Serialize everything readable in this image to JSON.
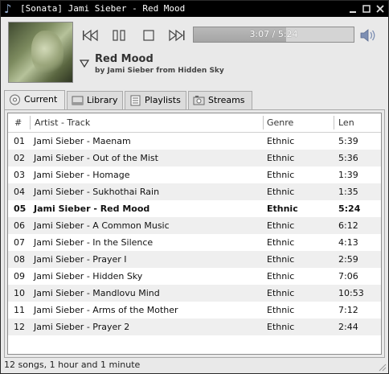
{
  "window": {
    "title": "[Sonata] Jami Sieber - Red Mood"
  },
  "player": {
    "progress_label": "3:07 / 5:24",
    "progress_fraction": 0.577,
    "song_title": "Red Mood",
    "song_subtitle": "by Jami Sieber from Hidden Sky"
  },
  "tabs": [
    {
      "label": "Current",
      "icon": "disc-icon",
      "active": true
    },
    {
      "label": "Library",
      "icon": "library-icon",
      "active": false
    },
    {
      "label": "Playlists",
      "icon": "playlist-icon",
      "active": false
    },
    {
      "label": "Streams",
      "icon": "streams-icon",
      "active": false
    }
  ],
  "playlist": {
    "columns": [
      "#",
      "Artist - Track",
      "Genre",
      "Len"
    ],
    "current_index": 4,
    "rows": [
      {
        "num": "01",
        "track": "Jami Sieber - Maenam",
        "genre": "Ethnic",
        "len": "5:39"
      },
      {
        "num": "02",
        "track": "Jami Sieber - Out of the Mist",
        "genre": "Ethnic",
        "len": "5:36"
      },
      {
        "num": "03",
        "track": "Jami Sieber - Homage",
        "genre": "Ethnic",
        "len": "1:39"
      },
      {
        "num": "04",
        "track": "Jami Sieber - Sukhothai Rain",
        "genre": "Ethnic",
        "len": "1:35"
      },
      {
        "num": "05",
        "track": "Jami Sieber - Red Mood",
        "genre": "Ethnic",
        "len": "5:24"
      },
      {
        "num": "06",
        "track": "Jami Sieber - A Common Music",
        "genre": "Ethnic",
        "len": "6:12"
      },
      {
        "num": "07",
        "track": "Jami Sieber - In the Silence",
        "genre": "Ethnic",
        "len": "4:13"
      },
      {
        "num": "08",
        "track": "Jami Sieber - Prayer I",
        "genre": "Ethnic",
        "len": "2:59"
      },
      {
        "num": "09",
        "track": "Jami Sieber - Hidden Sky",
        "genre": "Ethnic",
        "len": "7:06"
      },
      {
        "num": "10",
        "track": "Jami Sieber - Mandlovu Mind",
        "genre": "Ethnic",
        "len": "10:53"
      },
      {
        "num": "11",
        "track": "Jami Sieber - Arms of the Mother",
        "genre": "Ethnic",
        "len": "7:12"
      },
      {
        "num": "12",
        "track": "Jami Sieber - Prayer 2",
        "genre": "Ethnic",
        "len": "2:44"
      }
    ]
  },
  "status": {
    "text": "12 songs, 1 hour and 1 minute"
  }
}
